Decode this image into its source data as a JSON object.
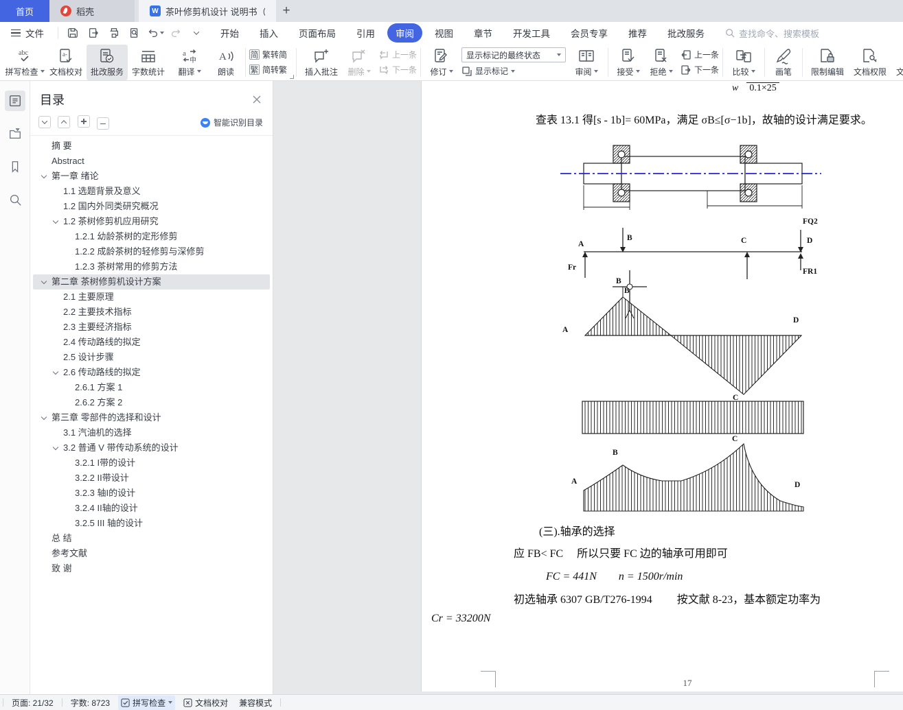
{
  "tab_bar": {
    "home": "首页",
    "docer": "稻壳",
    "doc_title": "茶叶修剪机设计 说明书（论文）",
    "new_tab": "+"
  },
  "menu_bar": {
    "file": "文件",
    "items": [
      "开始",
      "插入",
      "页面布局",
      "引用",
      "审阅",
      "视图",
      "章节",
      "开发工具",
      "会员专享",
      "推荐",
      "批改服务"
    ],
    "active": "审阅",
    "search_placeholder": "查找命令、搜索模板"
  },
  "ribbon": {
    "spell_check": "拼写检查",
    "doc_proof": "文档校对",
    "correction_service": "批改服务",
    "word_count": "字数统计",
    "translate": "翻译",
    "read_aloud": "朗读",
    "trad_to_simp": "繁转简",
    "simp_to_trad": "简转繁",
    "insert_comment": "插入批注",
    "delete_comment": "删除",
    "prev_comment": "上一条",
    "next_comment": "下一条",
    "track_changes": "修订",
    "markup_state": "显示标记的最终状态",
    "show_markup": "显示标记",
    "review": "审阅",
    "accept": "接受",
    "reject": "拒绝",
    "prev_change": "上一条",
    "next_change": "下一条",
    "compare": "比较",
    "brush": "画笔",
    "restrict_edit": "限制编辑",
    "doc_permission": "文档权限",
    "doc_certify": "文档认证"
  },
  "sidebar": {
    "title": "目录",
    "smart": "智能识别目录",
    "items": [
      {
        "text": "摘  要",
        "level": 0,
        "chevron": false,
        "selected": false
      },
      {
        "text": "Abstract",
        "level": 0,
        "chevron": false,
        "selected": false
      },
      {
        "text": "第一章 绪论",
        "level": 0,
        "chevron": true,
        "selected": false
      },
      {
        "text": "1.1 选题背景及意义",
        "level": 1,
        "chevron": false,
        "selected": false
      },
      {
        "text": "1.2 国内外同类研究概况",
        "level": 1,
        "chevron": false,
        "selected": false
      },
      {
        "text": "1.2 茶树修剪机应用研究",
        "level": 1,
        "chevron": true,
        "selected": false
      },
      {
        "text": "1.2.1 幼龄茶树的定形修剪",
        "level": 2,
        "chevron": false,
        "selected": false
      },
      {
        "text": "1.2.2 成龄茶树的轻修剪与深修剪",
        "level": 2,
        "chevron": false,
        "selected": false
      },
      {
        "text": "1.2.3 茶树常用的修剪方法",
        "level": 2,
        "chevron": false,
        "selected": false
      },
      {
        "text": "第二章 茶树修剪机设计方案",
        "level": 0,
        "chevron": true,
        "selected": true
      },
      {
        "text": "2.1 主要原理",
        "level": 1,
        "chevron": false,
        "selected": false
      },
      {
        "text": "2.2 主要技术指标",
        "level": 1,
        "chevron": false,
        "selected": false
      },
      {
        "text": "2.3 主要经济指标",
        "level": 1,
        "chevron": false,
        "selected": false
      },
      {
        "text": "2.4 传动路线的拟定",
        "level": 1,
        "chevron": false,
        "selected": false
      },
      {
        "text": "2.5 设计步骤",
        "level": 1,
        "chevron": false,
        "selected": false
      },
      {
        "text": "2.6 传动路线的拟定",
        "level": 1,
        "chevron": true,
        "selected": false
      },
      {
        "text": "2.6.1 方案 1",
        "level": 2,
        "chevron": false,
        "selected": false
      },
      {
        "text": "2.6.2 方案 2",
        "level": 2,
        "chevron": false,
        "selected": false
      },
      {
        "text": "第三章 零部件的选择和设计",
        "level": 0,
        "chevron": true,
        "selected": false
      },
      {
        "text": "3.1 汽油机的选择",
        "level": 1,
        "chevron": false,
        "selected": false
      },
      {
        "text": "3.2 普通 V 带传动系统的设计",
        "level": 1,
        "chevron": true,
        "selected": false
      },
      {
        "text": "3.2.1 I带的设计",
        "level": 2,
        "chevron": false,
        "selected": false
      },
      {
        "text": "3.2.2 II带设计",
        "level": 2,
        "chevron": false,
        "selected": false
      },
      {
        "text": "3.2.3 轴I的设计",
        "level": 2,
        "chevron": false,
        "selected": false
      },
      {
        "text": "3.2.4 II轴的设计",
        "level": 2,
        "chevron": false,
        "selected": false
      },
      {
        "text": "3.2.5 III 轴的设计",
        "level": 2,
        "chevron": false,
        "selected": false
      },
      {
        "text": "总  结",
        "level": 0,
        "chevron": false,
        "selected": false
      },
      {
        "text": "参考文献",
        "level": 0,
        "chevron": false,
        "selected": false
      },
      {
        "text": "致  谢",
        "level": 0,
        "chevron": false,
        "selected": false
      }
    ]
  },
  "document": {
    "frac_w": "w",
    "frac_den": "0.1×25",
    "check_line": "查表 13.1 得[s - 1b]= 60MPa，满足 σB≤[σ−1b]，故轴的设计满足要求。",
    "heading": "(三).轴承的选择",
    "cond_line": "应 FB< FC　 所以只要 FC 边的轴承可用即可",
    "values_line": "FC = 441N　　n = 1500r/min",
    "bearing_line": "初选轴承 6307 GB/T276-1994　　 按文献 8-23，基本额定功率为",
    "cr_line": "Cr = 33200N",
    "page_number": "17",
    "labels": {
      "A": "A",
      "B": "B",
      "C": "C",
      "D": "D",
      "Fr": "Fr",
      "FQ2": "FQ2",
      "FR1": "FR1"
    }
  },
  "status_bar": {
    "page": "页面: 21/32",
    "words": "字数: 8723",
    "spell": "拼写检查",
    "proof": "文档校对",
    "compat": "兼容模式"
  }
}
